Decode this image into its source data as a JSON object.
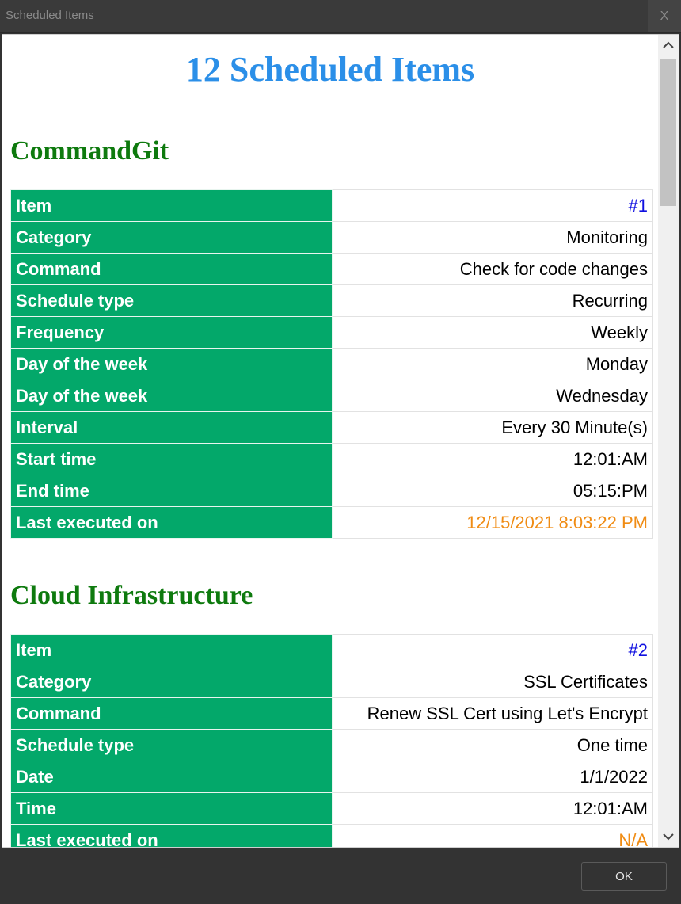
{
  "window": {
    "title": "Scheduled Items",
    "close_label": "X"
  },
  "heading": "12 Scheduled Items",
  "sections": [
    {
      "title": "CommandGit",
      "rows": [
        {
          "key": "Item",
          "value": "#1"
        },
        {
          "key": "Category",
          "value": "Monitoring"
        },
        {
          "key": "Command",
          "value": "Check for code changes"
        },
        {
          "key": "Schedule type",
          "value": "Recurring"
        },
        {
          "key": "Frequency",
          "value": "Weekly"
        },
        {
          "key": "Day of the week",
          "value": "Monday"
        },
        {
          "key": "Day of the week",
          "value": "Wednesday"
        },
        {
          "key": "Interval",
          "value": "Every 30 Minute(s)"
        },
        {
          "key": "Start time",
          "value": "12:01:AM"
        },
        {
          "key": "End time",
          "value": "05:15:PM"
        },
        {
          "key": "Last executed on",
          "value": "12/15/2021 8:03:22 PM"
        }
      ]
    },
    {
      "title": "Cloud Infrastructure",
      "rows": [
        {
          "key": "Item",
          "value": "#2"
        },
        {
          "key": "Category",
          "value": "SSL Certificates"
        },
        {
          "key": "Command",
          "value": "Renew SSL Cert using Let's Encrypt"
        },
        {
          "key": "Schedule type",
          "value": "One time"
        },
        {
          "key": "Date",
          "value": "1/1/2022"
        },
        {
          "key": "Time",
          "value": "12:01:AM"
        },
        {
          "key": "Last executed on",
          "value": "N/A"
        }
      ]
    }
  ],
  "footer": {
    "ok_label": "OK"
  },
  "colors": {
    "heading": "#2b8fe8",
    "section_title": "#0e7a0e",
    "key_cell": "#03a86a",
    "item_link": "#1010e0",
    "last_executed": "#f08c14"
  },
  "icons": {
    "scroll_up": "chevron-up-icon",
    "scroll_down": "chevron-down-icon"
  }
}
